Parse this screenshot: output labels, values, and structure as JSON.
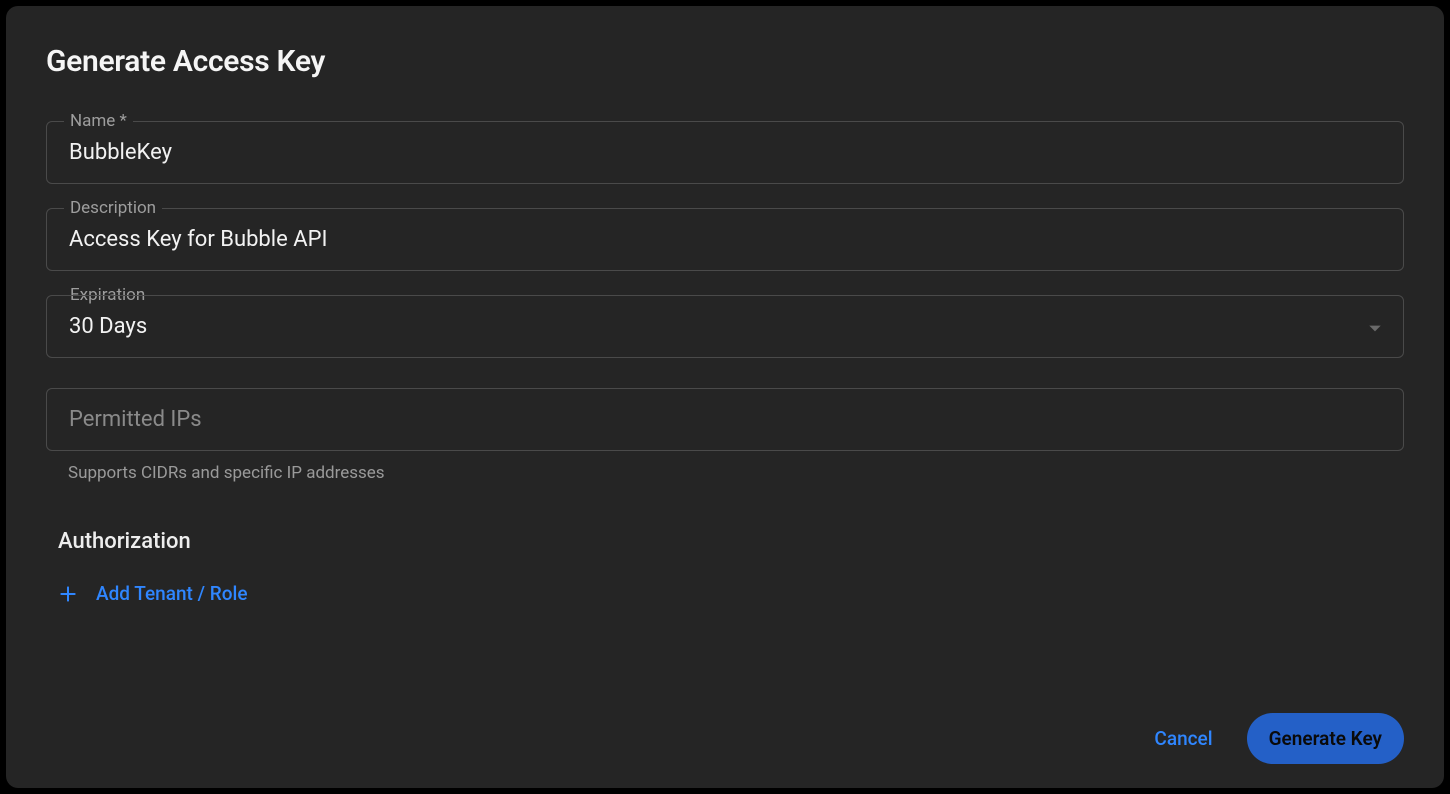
{
  "title": "Generate Access Key",
  "fields": {
    "name": {
      "label": "Name *",
      "value": "BubbleKey"
    },
    "description": {
      "label": "Description",
      "value": "Access Key for Bubble API"
    },
    "expiration": {
      "label": "Expiration",
      "value": "30 Days"
    },
    "permitted_ips": {
      "placeholder": "Permitted IPs",
      "helper": "Supports CIDRs and specific IP addresses"
    }
  },
  "authorization": {
    "section_label": "Authorization",
    "add_label": "Add Tenant / Role"
  },
  "footer": {
    "cancel": "Cancel",
    "generate": "Generate Key"
  },
  "colors": {
    "accent": "#2f86ff",
    "primary_button_bg": "#2460c7",
    "modal_bg": "#252525"
  }
}
